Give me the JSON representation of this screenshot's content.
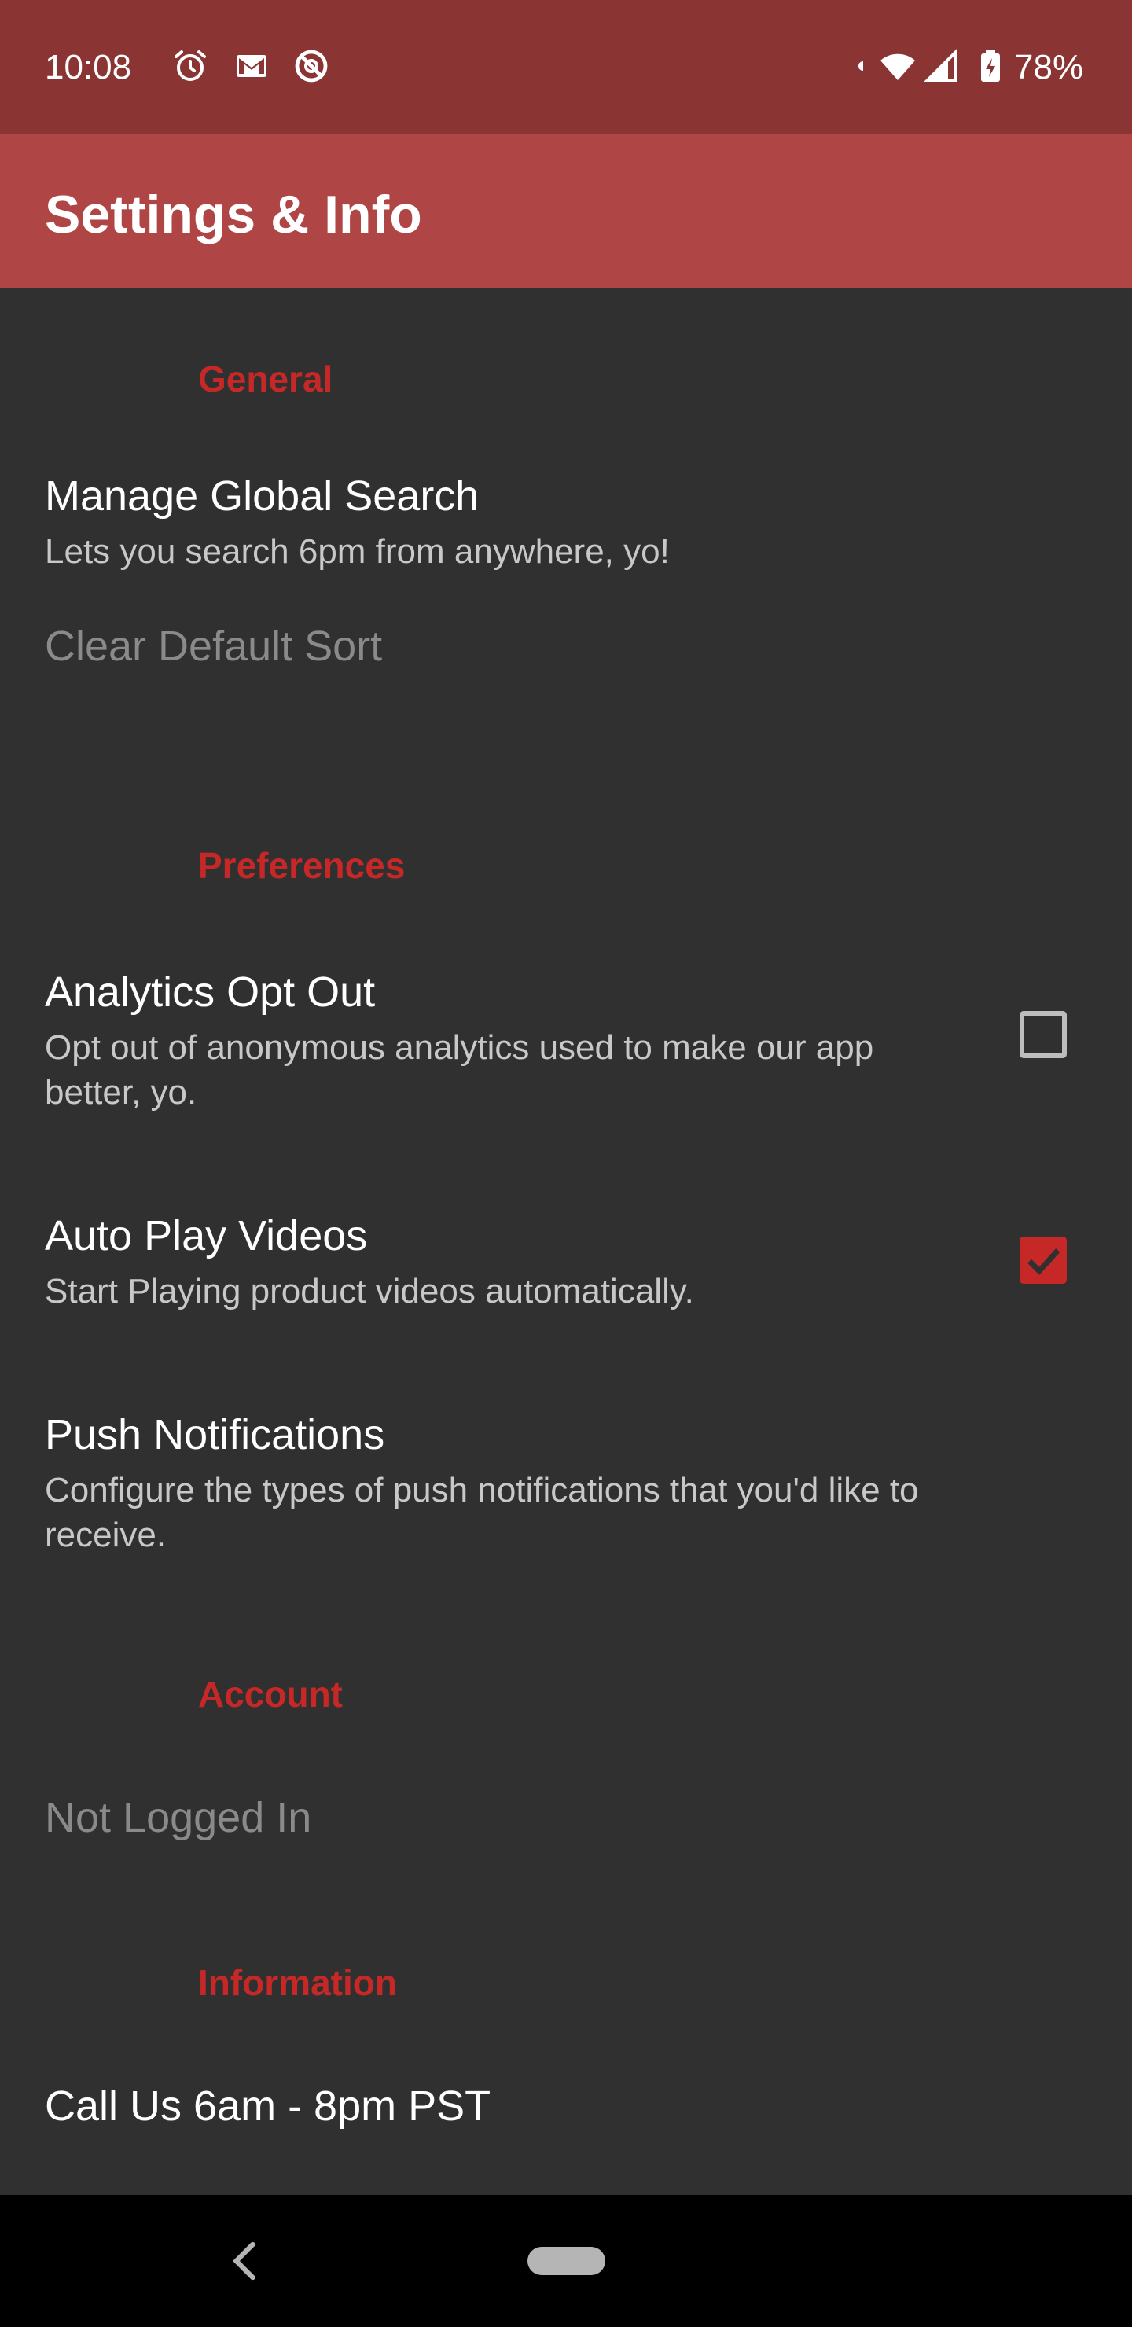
{
  "status_bar": {
    "time": "10:08",
    "battery_percent": "78%",
    "icons": [
      "alarm-icon",
      "gmail-icon",
      "do-not-disturb-icon",
      "notification-dot-icon",
      "wifi-icon",
      "cell-signal-icon",
      "battery-charging-icon"
    ]
  },
  "app_bar": {
    "title": "Settings & Info",
    "color": "#b04545"
  },
  "settings": {
    "general": {
      "header": "General",
      "manage_global_search": {
        "title": "Manage Global Search",
        "summary": "Lets you search 6pm from anywhere, yo!"
      },
      "clear_default_sort": {
        "title": "Clear Default Sort"
      }
    },
    "preferences": {
      "header": "Preferences",
      "analytics_opt_out": {
        "title": "Analytics Opt Out",
        "summary": "Opt out of anonymous analytics used to make our app better, yo.",
        "checked": false
      },
      "auto_play_videos": {
        "title": "Auto Play Videos",
        "summary": "Start Playing product videos automatically.",
        "checked": true
      },
      "push_notifications": {
        "title": "Push Notifications",
        "summary": "Configure the types of push notifications that you'd like to receive."
      }
    },
    "account": {
      "header": "Account",
      "not_logged_in": {
        "title": "Not Logged In"
      }
    },
    "information": {
      "header": "Information",
      "call_us": {
        "title": "Call Us 6am - 8pm PST"
      }
    }
  },
  "colors": {
    "accent": "#c62828",
    "status_bar": "#8b3434",
    "background": "#303030"
  }
}
